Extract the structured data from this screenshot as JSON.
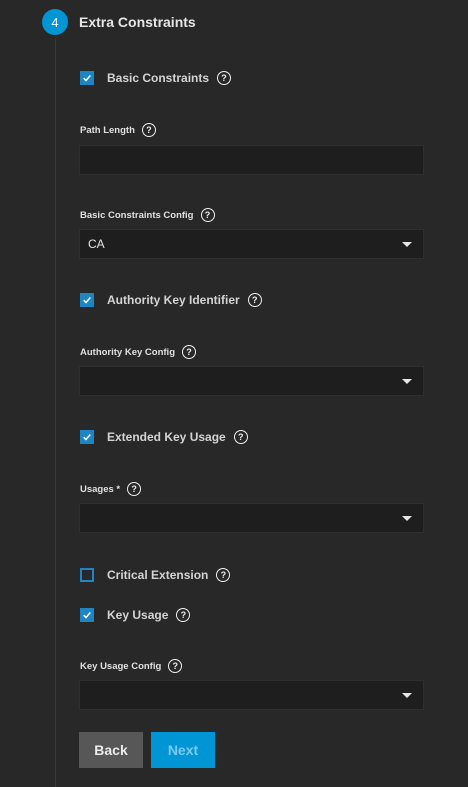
{
  "step": {
    "number": "4",
    "title": "Extra Constraints"
  },
  "basic_constraints": {
    "label": "Basic Constraints",
    "checked": true
  },
  "path_length": {
    "label": "Path Length",
    "value": ""
  },
  "basic_constraints_config": {
    "label": "Basic Constraints Config",
    "value": "CA"
  },
  "authority_key_identifier": {
    "label": "Authority Key Identifier",
    "checked": true
  },
  "authority_key_config": {
    "label": "Authority Key Config",
    "value": ""
  },
  "extended_key_usage": {
    "label": "Extended Key Usage",
    "checked": true
  },
  "usages": {
    "label": "Usages *",
    "value": ""
  },
  "critical_extension": {
    "label": "Critical Extension",
    "checked": false
  },
  "key_usage": {
    "label": "Key Usage",
    "checked": true
  },
  "key_usage_config": {
    "label": "Key Usage Config",
    "value": ""
  },
  "buttons": {
    "back": "Back",
    "next": "Next"
  },
  "icons": {
    "help": "?"
  },
  "colors": {
    "accent": "#0095d5",
    "checkbox": "#1d86c2",
    "background": "#282828",
    "field": "#1e1e1e"
  }
}
